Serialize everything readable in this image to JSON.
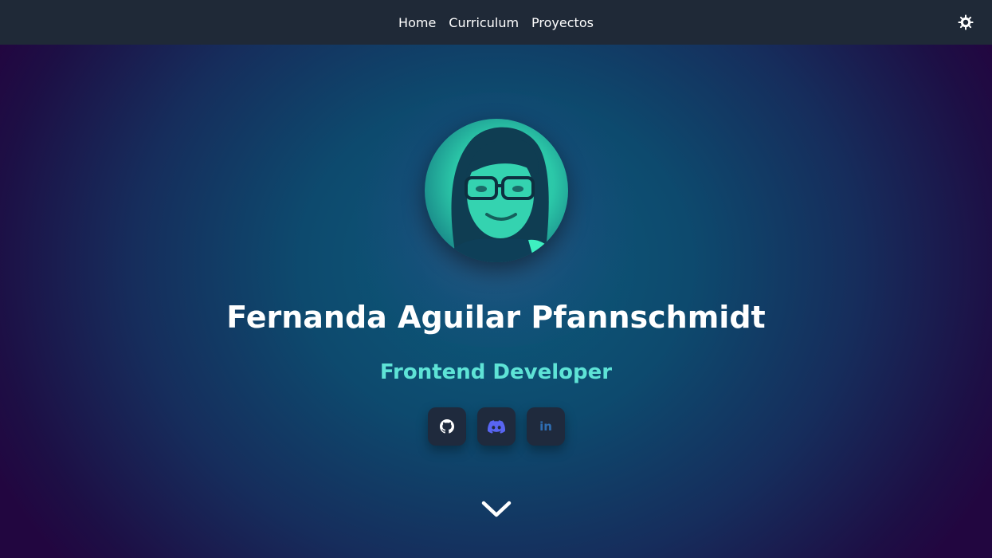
{
  "nav": {
    "links": [
      "Home",
      "Curriculum",
      "Proyectos"
    ],
    "theme_toggle_icon": "sun-icon"
  },
  "hero": {
    "name": "Fernanda Aguilar Pfannschmidt",
    "role": "Frontend Developer",
    "avatar_icon": "profile-photo",
    "socials": [
      {
        "icon": "github-icon",
        "label": ""
      },
      {
        "icon": "discord-icon",
        "label": ""
      },
      {
        "icon": "linkedin-icon",
        "label": "in"
      }
    ],
    "scroll_icon": "chevron-down-icon"
  },
  "colors": {
    "navbar_bg": "#1f2937",
    "accent": "#5ee3d6",
    "discord": "#5865f2",
    "linkedin": "#2f6eb3"
  }
}
